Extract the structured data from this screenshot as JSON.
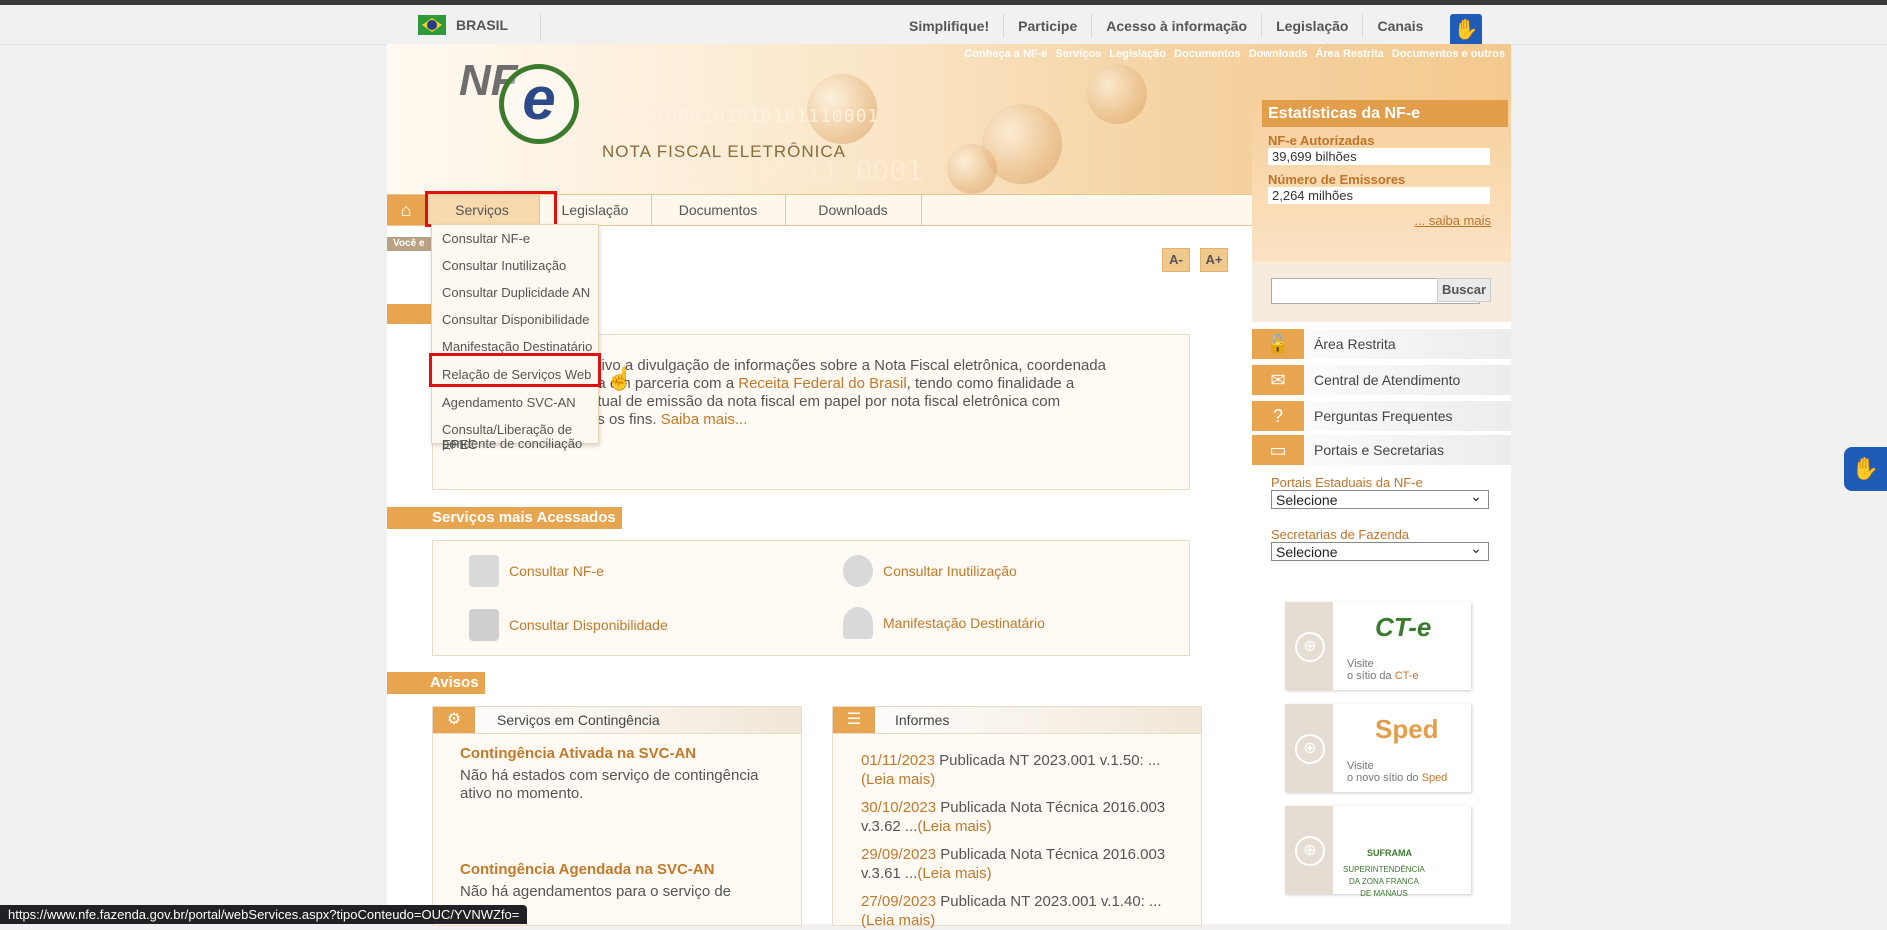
{
  "govbar": {
    "country": "BRASIL",
    "links": [
      "Simplifique!",
      "Participe",
      "Acesso à informação",
      "Legislação",
      "Canais"
    ]
  },
  "header": {
    "nav": [
      "Conheça a NF-e",
      "Serviços",
      "Legislação",
      "Documentos",
      "Downloads",
      "Área Restrita",
      "Documentos e outros"
    ],
    "logo_nf": "NF",
    "logo_e": "e",
    "logo_text": "NOTA FISCAL ELETRÔNICA",
    "binary_1": "01011000101010101110001",
    "binary_2": "101010111 0001"
  },
  "menu": {
    "home_icon": "⌂",
    "items": [
      "Serviços",
      "Legislação",
      "Documentos",
      "Downloads"
    ],
    "breadcrumb": "Você e"
  },
  "dropdown": [
    "Consultar NF-e",
    "Consultar Inutilização",
    "Consultar Duplicidade AN",
    "Consultar Disponibilidade",
    "Manifestação Destinatário",
    "Relação de Serviços Web",
    "Agendamento SVC-AN",
    "Consulta/Liberação de EPEC",
    "pendente de conciliação"
  ],
  "font_buttons": {
    "decrease": "A-",
    "increase": "A+"
  },
  "intro": {
    "line1": "etivo a divulgação de informações sobre a Nota Fiscal eletrônica, coordenada",
    "line2a": "da em parceria com a ",
    "line2b": "Receita Federal do Brasil",
    "line2c": ", tendo como finalidade a",
    "line3": "atual de emissão da nota fiscal em papel por nota fiscal eletrônica com",
    "line4a": "os os fins. ",
    "line4b": "Saiba mais..."
  },
  "services": {
    "title": "Serviços mais Acessados",
    "items": [
      "Consultar NF-e",
      "Consultar Inutilização",
      "Consultar Disponibilidade",
      "Manifestação Destinatário"
    ]
  },
  "avisos": {
    "title": "Avisos",
    "contingencia": {
      "title": "Serviços em Contingência",
      "items": [
        {
          "title": "Contingência Ativada na SVC-AN",
          "body": "Não há estados com serviço de contingência ativo no momento."
        },
        {
          "title": "Contingência Agendada na SVC-AN",
          "body": "Não há agendamentos para o serviço de"
        }
      ]
    },
    "informes": {
      "title": "Informes",
      "items": [
        {
          "date": "01/11/2023",
          "text": " Publicada NT 2023.001 v.1.50: ...",
          "more": "(Leia mais)"
        },
        {
          "date": "30/10/2023",
          "text": " Publicada Nota Técnica 2016.003 v.3.62 ...",
          "more": "(Leia mais)"
        },
        {
          "date": "29/09/2023",
          "text": " Publicada Nota Técnica 2016.003 v.3.61 ...",
          "more": "(Leia mais)"
        },
        {
          "date": "27/09/2023",
          "text": " Publicada NT 2023.001 v.1.40: ...",
          "more": "(Leia mais)"
        }
      ]
    }
  },
  "stats": {
    "title": "Estatísticas da NF-e",
    "authorized_label": "NF-e Autorizadas",
    "authorized_value": "39,699 bilhões",
    "issuers_label": "Número de Emissores",
    "issuers_value": "2,264 milhões",
    "more": "... saiba mais"
  },
  "search": {
    "button": "Buscar",
    "value": ""
  },
  "side_links": [
    "Área Restrita",
    "Central de Atendimento",
    "Perguntas Frequentes",
    "Portais e Secretarias"
  ],
  "selects": {
    "portais_label": "Portais Estaduais da NF-e",
    "portais_value": "Selecione",
    "secretarias_label": "Secretarias de Fazenda",
    "secretarias_value": "Selecione"
  },
  "banners": [
    {
      "brand": "CT-e",
      "visit": "Visite",
      "site_prefix": "o sítio da ",
      "site_name": "CT-e"
    },
    {
      "brand": "Sped",
      "visit": "Visite",
      "site_prefix": "o novo sítio do ",
      "site_name": "Sped"
    },
    {
      "brand": "SUFRAMA",
      "visit": "SUPERINTENDÊNCIA",
      "site_prefix": "DA ZONA FRANCA",
      "site_name": "DE MANAUS"
    }
  ],
  "status_url": "https://www.nfe.fazenda.gov.br/portal/webServices.aspx?tipoConteudo=OUC/YVNWZfo="
}
